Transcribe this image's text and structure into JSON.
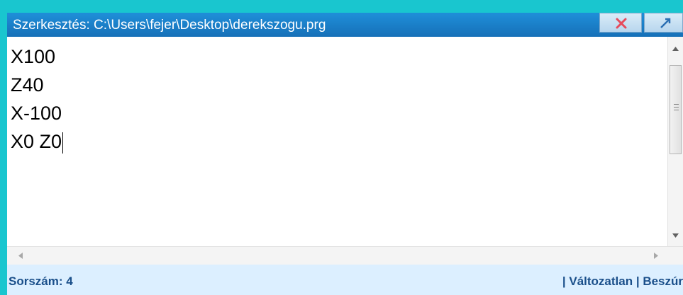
{
  "window": {
    "title": "Szerkesztés: C:\\Users\\fejer\\Desktop\\derekszogu.prg"
  },
  "title_buttons": {
    "close_icon": "close-icon",
    "maximize_icon": "maximize-icon"
  },
  "editor": {
    "lines": [
      "X100",
      "Z40",
      "X-100",
      "X0 Z0"
    ]
  },
  "status": {
    "line_number": "Sorszám: 4",
    "right": "| Változatlan | Beszúr"
  },
  "colors": {
    "frame": "#19c6cf",
    "titlebar": "#1a80c8",
    "status_bg": "#dcefff",
    "status_text": "#1a4f8a",
    "close_x": "#e64b5c"
  }
}
